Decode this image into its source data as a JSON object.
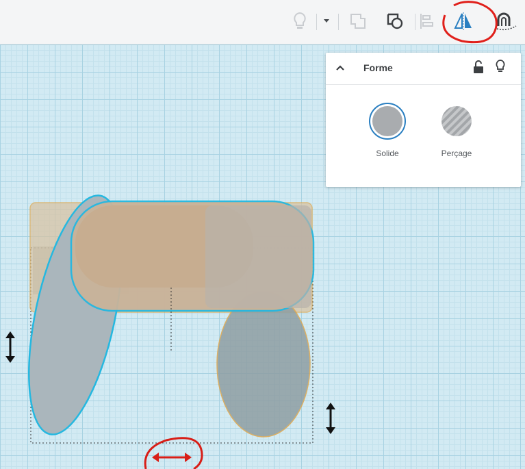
{
  "toolbar": {
    "tools": [
      {
        "icon": "lightbulb-icon",
        "name": "show-all"
      },
      {
        "icon": "chevron-down-icon",
        "name": "show-dropdown"
      },
      {
        "icon": "group-icon",
        "name": "group"
      },
      {
        "icon": "ungroup-icon",
        "name": "ungroup"
      },
      {
        "icon": "align-icon",
        "name": "align"
      },
      {
        "icon": "mirror-icon",
        "name": "mirror"
      },
      {
        "icon": "cruise-icon",
        "name": "cruise"
      }
    ],
    "accent_color": "#2a7fc1",
    "highlight_color": "#e0201b"
  },
  "inspector": {
    "title": "Forme",
    "options": [
      {
        "label": "Solide",
        "selected": true
      },
      {
        "label": "Perçage",
        "selected": false
      }
    ]
  }
}
